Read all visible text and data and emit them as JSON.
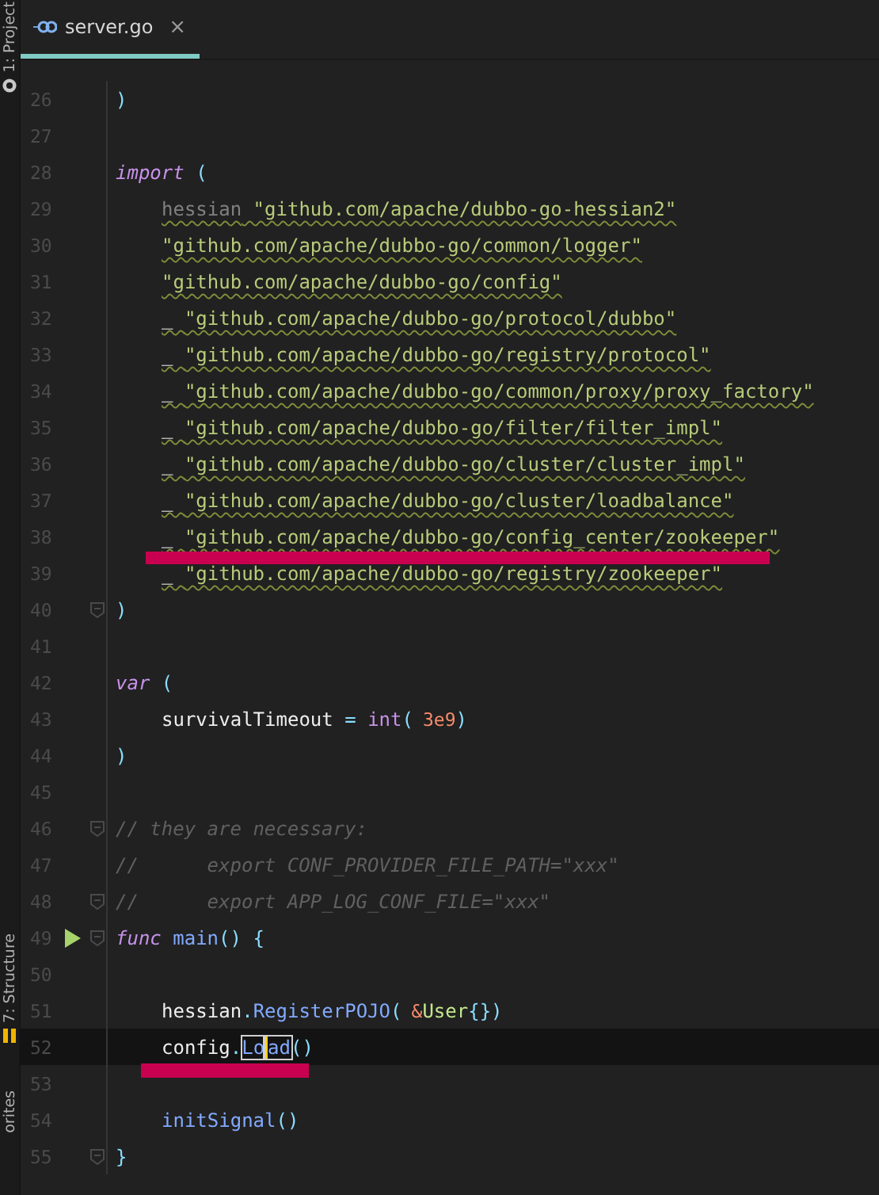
{
  "sidebar": {
    "items": [
      {
        "label": "1: Project",
        "kind": "project"
      },
      {
        "label": "7: Structure",
        "kind": "structure"
      },
      {
        "label": "orites",
        "kind": "favorites"
      }
    ]
  },
  "tabs": [
    {
      "label": "server.go",
      "close": "×",
      "selected": true
    }
  ],
  "lines": [
    {
      "number": "26",
      "fold": false,
      "run": false,
      "current": false,
      "warning": false,
      "indented": false,
      "tokens": [
        {
          "text": ")",
          "kind": "punct"
        }
      ]
    },
    {
      "number": "27",
      "fold": false,
      "run": false,
      "current": false
    },
    {
      "number": "28",
      "fold": false,
      "run": false,
      "current": false,
      "warning": false,
      "indented": false,
      "tokens": [
        {
          "text": "import",
          "kind": "kw"
        },
        {
          "text": " (",
          "kind": "punct"
        }
      ]
    },
    {
      "number": "29",
      "fold": false,
      "run": false,
      "current": false,
      "warning": true,
      "indented": true,
      "tokens": [
        {
          "text": "hessian",
          "kind": "unused"
        },
        {
          "text": " \"github.com/apache/dubbo-go-hessian2\"",
          "kind": "str"
        }
      ]
    },
    {
      "number": "30",
      "fold": false,
      "run": false,
      "current": false,
      "warning": true,
      "indented": true,
      "tokens": [
        {
          "text": "\"github.com/apache/dubbo-go/common/logger\"",
          "kind": "str"
        }
      ]
    },
    {
      "number": "31",
      "fold": false,
      "run": false,
      "current": false,
      "warning": true,
      "indented": true,
      "tokens": [
        {
          "text": "\"github.com/apache/dubbo-go/config\"",
          "kind": "str"
        }
      ]
    },
    {
      "number": "32",
      "fold": false,
      "run": false,
      "current": false,
      "warning": true,
      "indented": true,
      "tokens": [
        {
          "text": "_ ",
          "kind": "id"
        },
        {
          "text": "\"github.com/apache/dubbo-go/protocol/dubbo\"",
          "kind": "str"
        }
      ]
    },
    {
      "number": "33",
      "fold": false,
      "run": false,
      "current": false,
      "warning": true,
      "indented": true,
      "tokens": [
        {
          "text": "_ ",
          "kind": "id"
        },
        {
          "text": "\"github.com/apache/dubbo-go/registry/protocol\"",
          "kind": "str"
        }
      ]
    },
    {
      "number": "34",
      "fold": false,
      "run": false,
      "current": false,
      "warning": true,
      "indented": true,
      "tokens": [
        {
          "text": "_ ",
          "kind": "id"
        },
        {
          "text": "\"github.com/apache/dubbo-go/common/proxy/proxy_factory\"",
          "kind": "str"
        }
      ]
    },
    {
      "number": "35",
      "fold": false,
      "run": false,
      "current": false,
      "warning": true,
      "indented": true,
      "tokens": [
        {
          "text": "_ ",
          "kind": "id"
        },
        {
          "text": "\"github.com/apache/dubbo-go/filter/filter_impl\"",
          "kind": "str"
        }
      ]
    },
    {
      "number": "36",
      "fold": false,
      "run": false,
      "current": false,
      "warning": true,
      "indented": true,
      "tokens": [
        {
          "text": "_ ",
          "kind": "id"
        },
        {
          "text": "\"github.com/apache/dubbo-go/cluster/cluster_impl\"",
          "kind": "str"
        }
      ]
    },
    {
      "number": "37",
      "fold": false,
      "run": false,
      "current": false,
      "warning": true,
      "indented": true,
      "tokens": [
        {
          "text": "_ ",
          "kind": "id"
        },
        {
          "text": "\"github.com/apache/dubbo-go/cluster/loadbalance\"",
          "kind": "str"
        }
      ]
    },
    {
      "number": "38",
      "fold": false,
      "run": false,
      "current": false,
      "warning": true,
      "indented": true,
      "tokens": [
        {
          "text": "_ ",
          "kind": "id"
        },
        {
          "text": "\"github.com/apache/dubbo-go/config_center/zookeeper\"",
          "kind": "str"
        }
      ]
    },
    {
      "number": "39",
      "fold": false,
      "run": false,
      "current": false,
      "warning": true,
      "indented": true,
      "tokens": [
        {
          "text": "_ ",
          "kind": "id"
        },
        {
          "text": "\"github.com/apache/dubbo-go/registry/zookeeper\"",
          "kind": "str"
        }
      ]
    },
    {
      "number": "40",
      "fold": true,
      "run": false,
      "current": false,
      "warning": false,
      "indented": false,
      "tokens": [
        {
          "text": ")",
          "kind": "punct"
        }
      ]
    },
    {
      "number": "41",
      "fold": false,
      "run": false,
      "current": false
    },
    {
      "number": "42",
      "fold": false,
      "run": false,
      "current": false,
      "warning": false,
      "indented": false,
      "tokens": [
        {
          "text": "var",
          "kind": "kw"
        },
        {
          "text": " (",
          "kind": "punct"
        }
      ]
    },
    {
      "number": "43",
      "fold": false,
      "run": false,
      "current": false,
      "warning": false,
      "indented": true,
      "tokens": [
        {
          "text": "survivalTimeout",
          "kind": "id"
        },
        {
          "text": " = ",
          "kind": "punct"
        },
        {
          "text": "int",
          "kind": "builtin"
        },
        {
          "text": "(",
          "kind": "punct"
        },
        {
          "text": "3e9",
          "kind": "num"
        },
        {
          "text": ")",
          "kind": "punct"
        }
      ]
    },
    {
      "number": "44",
      "fold": false,
      "run": false,
      "current": false,
      "warning": false,
      "indented": false,
      "tokens": [
        {
          "text": ")",
          "kind": "punct"
        }
      ]
    },
    {
      "number": "45",
      "fold": false,
      "run": false,
      "current": false
    },
    {
      "number": "46",
      "fold": true,
      "run": false,
      "current": false,
      "warning": false,
      "indented": false,
      "tokens": [
        {
          "text": "// they are necessary:",
          "kind": "cmt"
        }
      ]
    },
    {
      "number": "47",
      "fold": false,
      "run": false,
      "current": false,
      "warning": false,
      "indented": false,
      "tokens": [
        {
          "text": "//      export CONF_PROVIDER_FILE_PATH=\"xxx\"",
          "kind": "cmt"
        }
      ]
    },
    {
      "number": "48",
      "fold": true,
      "run": false,
      "current": false,
      "warning": false,
      "indented": false,
      "tokens": [
        {
          "text": "//      export APP_LOG_CONF_FILE=\"xxx\"",
          "kind": "cmt"
        }
      ]
    },
    {
      "number": "49",
      "fold": true,
      "run": true,
      "current": false,
      "warning": false,
      "indented": false,
      "tokens": [
        {
          "text": "func",
          "kind": "kw"
        },
        {
          "text": " main",
          "kind": "fn"
        },
        {
          "text": "() {",
          "kind": "punct"
        }
      ]
    },
    {
      "number": "50",
      "fold": false,
      "run": false,
      "current": false
    },
    {
      "number": "51",
      "fold": false,
      "run": false,
      "current": false,
      "warning": false,
      "indented": true,
      "tokens": [
        {
          "text": "hessian",
          "kind": "id"
        },
        {
          "text": ".",
          "kind": "punct"
        },
        {
          "text": "RegisterPOJO",
          "kind": "fn"
        },
        {
          "text": "(",
          "kind": "punct"
        },
        {
          "text": "&",
          "kind": "num"
        },
        {
          "text": "User",
          "kind": "type"
        },
        {
          "text": "{})",
          "kind": "punct"
        }
      ]
    },
    {
      "number": "52",
      "fold": false,
      "run": false,
      "current": true,
      "warning": false,
      "indented": true,
      "tokens": [
        {
          "text": "config",
          "kind": "id"
        },
        {
          "text": ".",
          "kind": "punct"
        },
        {
          "text": "Lo",
          "kind": "match"
        },
        {
          "text": "ad",
          "kind": "match_caret"
        },
        {
          "text": "()",
          "kind": "punct"
        }
      ]
    },
    {
      "number": "53",
      "fold": false,
      "run": false,
      "current": false
    },
    {
      "number": "54",
      "fold": false,
      "run": false,
      "current": false,
      "warning": false,
      "indented": true,
      "tokens": [
        {
          "text": "initSignal",
          "kind": "fn"
        },
        {
          "text": "()",
          "kind": "punct"
        }
      ]
    },
    {
      "number": "55",
      "fold": true,
      "run": false,
      "current": false,
      "warning": false,
      "indented": false,
      "tokens": [
        {
          "text": "}",
          "kind": "punct"
        }
      ]
    }
  ]
}
